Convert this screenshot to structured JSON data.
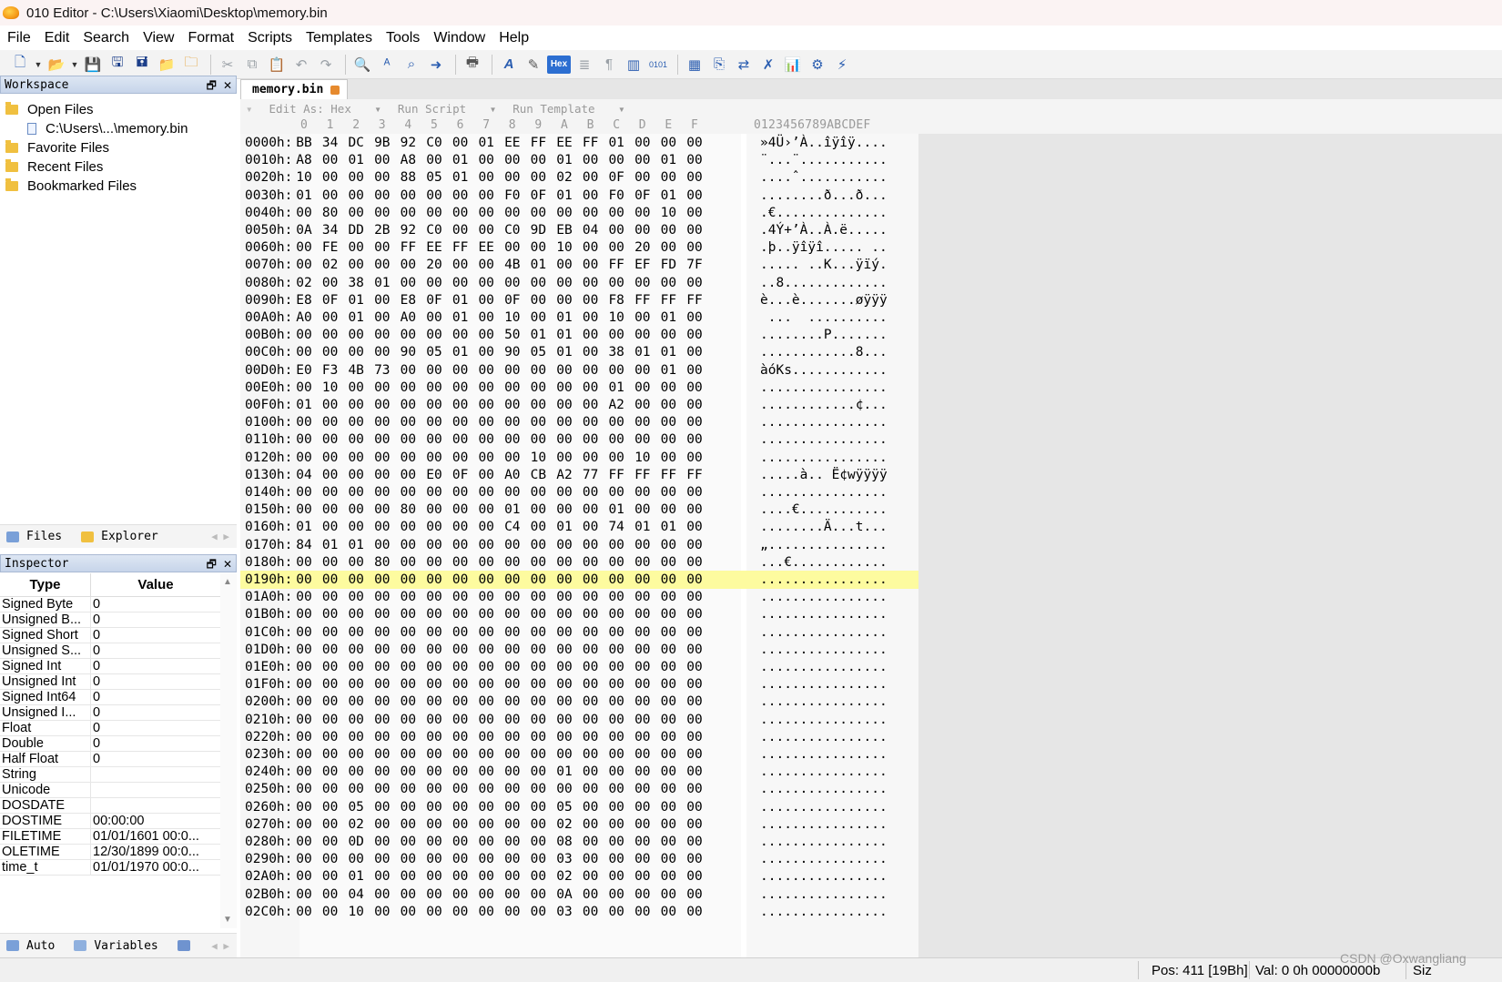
{
  "window": {
    "title": "010 Editor - C:\\Users\\Xiaomi\\Desktop\\memory.bin"
  },
  "menu": [
    "File",
    "Edit",
    "Search",
    "View",
    "Format",
    "Scripts",
    "Templates",
    "Tools",
    "Window",
    "Help"
  ],
  "toolbar": {
    "hex_label": "Hex"
  },
  "workspace": {
    "title": "Workspace",
    "items": [
      {
        "label": "Open Files",
        "level": 0
      },
      {
        "label": "C:\\Users\\...\\memory.bin",
        "level": 1
      },
      {
        "label": "Favorite Files",
        "level": 0
      },
      {
        "label": "Recent Files",
        "level": 0
      },
      {
        "label": "Bookmarked Files",
        "level": 0
      }
    ],
    "tabs": [
      "Files",
      "Explorer"
    ]
  },
  "inspector": {
    "title": "Inspector",
    "col_type": "Type",
    "col_value": "Value",
    "rows": [
      {
        "type": "Signed Byte",
        "value": "0"
      },
      {
        "type": "Unsigned B...",
        "value": "0"
      },
      {
        "type": "Signed Short",
        "value": "0"
      },
      {
        "type": "Unsigned S...",
        "value": "0"
      },
      {
        "type": "Signed Int",
        "value": "0"
      },
      {
        "type": "Unsigned Int",
        "value": "0"
      },
      {
        "type": "Signed Int64",
        "value": "0"
      },
      {
        "type": "Unsigned I...",
        "value": "0"
      },
      {
        "type": "Float",
        "value": "0"
      },
      {
        "type": "Double",
        "value": "0"
      },
      {
        "type": "Half Float",
        "value": "0"
      },
      {
        "type": "String",
        "value": ""
      },
      {
        "type": "Unicode",
        "value": ""
      },
      {
        "type": "DOSDATE",
        "value": ""
      },
      {
        "type": "DOSTIME",
        "value": "00:00:00"
      },
      {
        "type": "FILETIME",
        "value": "01/01/1601 00:0..."
      },
      {
        "type": "OLETIME",
        "value": "12/30/1899 00:0..."
      },
      {
        "type": "time_t",
        "value": "01/01/1970 00:0..."
      }
    ],
    "tabs": [
      "Auto",
      "Variables"
    ]
  },
  "editor": {
    "tab_label": "memory.bin",
    "bar": [
      "Edit As: Hex",
      "Run Script",
      "Run Template"
    ],
    "col_headers": [
      "0",
      "1",
      "2",
      "3",
      "4",
      "5",
      "6",
      "7",
      "8",
      "9",
      "A",
      "B",
      "C",
      "D",
      "E",
      "F"
    ],
    "ascii_header": "0123456789ABCDEF",
    "highlight_row": "0190h:",
    "rows": [
      {
        "addr": "0000h:",
        "hex": "BB 34 DC 9B 92 C0 00 01 EE FF EE FF 01 00 00 00",
        "ascii": "»4Ü›’À..îÿîÿ...."
      },
      {
        "addr": "0010h:",
        "hex": "A8 00 01 00 A8 00 01 00 00 00 01 00 00 00 01 00",
        "ascii": "¨...¨..........."
      },
      {
        "addr": "0020h:",
        "hex": "10 00 00 00 88 05 01 00 00 00 02 00 0F 00 00 00",
        "ascii": "....ˆ..........."
      },
      {
        "addr": "0030h:",
        "hex": "01 00 00 00 00 00 00 00 F0 0F 01 00 F0 0F 01 00",
        "ascii": "........ð...ð..."
      },
      {
        "addr": "0040h:",
        "hex": "00 80 00 00 00 00 00 00 00 00 00 00 00 00 10 00",
        "ascii": ".€.............."
      },
      {
        "addr": "0050h:",
        "hex": "0A 34 DD 2B 92 C0 00 00 C0 9D EB 04 00 00 00 00",
        "ascii": ".4Ý+’À..À.ë....."
      },
      {
        "addr": "0060h:",
        "hex": "00 FE 00 00 FF EE FF EE 00 00 10 00 00 20 00 00",
        "ascii": ".þ..ÿîÿî..... .."
      },
      {
        "addr": "0070h:",
        "hex": "00 02 00 00 00 20 00 00 4B 01 00 00 FF EF FD 7F",
        "ascii": "..... ..K...ÿïý."
      },
      {
        "addr": "0080h:",
        "hex": "02 00 38 01 00 00 00 00 00 00 00 00 00 00 00 00",
        "ascii": "..8............."
      },
      {
        "addr": "0090h:",
        "hex": "E8 0F 01 00 E8 0F 01 00 0F 00 00 00 F8 FF FF FF",
        "ascii": "è...è.......øÿÿÿ"
      },
      {
        "addr": "00A0h:",
        "hex": "A0 00 01 00 A0 00 01 00 10 00 01 00 10 00 01 00",
        "ascii": " ...  .........."
      },
      {
        "addr": "00B0h:",
        "hex": "00 00 00 00 00 00 00 00 50 01 01 00 00 00 00 00",
        "ascii": "........P......."
      },
      {
        "addr": "00C0h:",
        "hex": "00 00 00 00 90 05 01 00 90 05 01 00 38 01 01 00",
        "ascii": "............8..."
      },
      {
        "addr": "00D0h:",
        "hex": "E0 F3 4B 73 00 00 00 00 00 00 00 00 00 00 01 00",
        "ascii": "àóKs............"
      },
      {
        "addr": "00E0h:",
        "hex": "00 10 00 00 00 00 00 00 00 00 00 00 01 00 00 00",
        "ascii": "................"
      },
      {
        "addr": "00F0h:",
        "hex": "01 00 00 00 00 00 00 00 00 00 00 00 A2 00 00 00",
        "ascii": "............¢..."
      },
      {
        "addr": "0100h:",
        "hex": "00 00 00 00 00 00 00 00 00 00 00 00 00 00 00 00",
        "ascii": "................"
      },
      {
        "addr": "0110h:",
        "hex": "00 00 00 00 00 00 00 00 00 00 00 00 00 00 00 00",
        "ascii": "................"
      },
      {
        "addr": "0120h:",
        "hex": "00 00 00 00 00 00 00 00 00 10 00 00 00 10 00 00",
        "ascii": "................"
      },
      {
        "addr": "0130h:",
        "hex": "04 00 00 00 00 E0 0F 00 A0 CB A2 77 FF FF FF FF",
        "ascii": ".....à.. Ë¢wÿÿÿÿ"
      },
      {
        "addr": "0140h:",
        "hex": "00 00 00 00 00 00 00 00 00 00 00 00 00 00 00 00",
        "ascii": "................"
      },
      {
        "addr": "0150h:",
        "hex": "00 00 00 00 80 00 00 00 01 00 00 00 01 00 00 00",
        "ascii": "....€..........."
      },
      {
        "addr": "0160h:",
        "hex": "01 00 00 00 00 00 00 00 C4 00 01 00 74 01 01 00",
        "ascii": "........Ä...t..."
      },
      {
        "addr": "0170h:",
        "hex": "84 01 01 00 00 00 00 00 00 00 00 00 00 00 00 00",
        "ascii": "„..............."
      },
      {
        "addr": "0180h:",
        "hex": "00 00 00 80 00 00 00 00 00 00 00 00 00 00 00 00",
        "ascii": "...€............"
      },
      {
        "addr": "0190h:",
        "hex": "00 00 00 00 00 00 00 00 00 00 00 00 00 00 00 00",
        "ascii": "................"
      },
      {
        "addr": "01A0h:",
        "hex": "00 00 00 00 00 00 00 00 00 00 00 00 00 00 00 00",
        "ascii": "................"
      },
      {
        "addr": "01B0h:",
        "hex": "00 00 00 00 00 00 00 00 00 00 00 00 00 00 00 00",
        "ascii": "................"
      },
      {
        "addr": "01C0h:",
        "hex": "00 00 00 00 00 00 00 00 00 00 00 00 00 00 00 00",
        "ascii": "................"
      },
      {
        "addr": "01D0h:",
        "hex": "00 00 00 00 00 00 00 00 00 00 00 00 00 00 00 00",
        "ascii": "................"
      },
      {
        "addr": "01E0h:",
        "hex": "00 00 00 00 00 00 00 00 00 00 00 00 00 00 00 00",
        "ascii": "................"
      },
      {
        "addr": "01F0h:",
        "hex": "00 00 00 00 00 00 00 00 00 00 00 00 00 00 00 00",
        "ascii": "................"
      },
      {
        "addr": "0200h:",
        "hex": "00 00 00 00 00 00 00 00 00 00 00 00 00 00 00 00",
        "ascii": "................"
      },
      {
        "addr": "0210h:",
        "hex": "00 00 00 00 00 00 00 00 00 00 00 00 00 00 00 00",
        "ascii": "................"
      },
      {
        "addr": "0220h:",
        "hex": "00 00 00 00 00 00 00 00 00 00 00 00 00 00 00 00",
        "ascii": "................"
      },
      {
        "addr": "0230h:",
        "hex": "00 00 00 00 00 00 00 00 00 00 00 00 00 00 00 00",
        "ascii": "................"
      },
      {
        "addr": "0240h:",
        "hex": "00 00 00 00 00 00 00 00 00 00 01 00 00 00 00 00",
        "ascii": "................"
      },
      {
        "addr": "0250h:",
        "hex": "00 00 00 00 00 00 00 00 00 00 00 00 00 00 00 00",
        "ascii": "................"
      },
      {
        "addr": "0260h:",
        "hex": "00 00 05 00 00 00 00 00 00 00 05 00 00 00 00 00",
        "ascii": "................"
      },
      {
        "addr": "0270h:",
        "hex": "00 00 02 00 00 00 00 00 00 00 02 00 00 00 00 00",
        "ascii": "................"
      },
      {
        "addr": "0280h:",
        "hex": "00 00 0D 00 00 00 00 00 00 00 08 00 00 00 00 00",
        "ascii": "................"
      },
      {
        "addr": "0290h:",
        "hex": "00 00 00 00 00 00 00 00 00 00 03 00 00 00 00 00",
        "ascii": "................"
      },
      {
        "addr": "02A0h:",
        "hex": "00 00 01 00 00 00 00 00 00 00 02 00 00 00 00 00",
        "ascii": "................"
      },
      {
        "addr": "02B0h:",
        "hex": "00 00 04 00 00 00 00 00 00 00 0A 00 00 00 00 00",
        "ascii": "................"
      },
      {
        "addr": "02C0h:",
        "hex": "00 00 10 00 00 00 00 00 00 00 03 00 00 00 00 00",
        "ascii": "................"
      }
    ]
  },
  "status": {
    "pos": "Pos: 411 [19Bh]",
    "val": "Val: 0 0h 00000000b",
    "siz": "Siz"
  },
  "watermark": "CSDN @Oxwangliang"
}
